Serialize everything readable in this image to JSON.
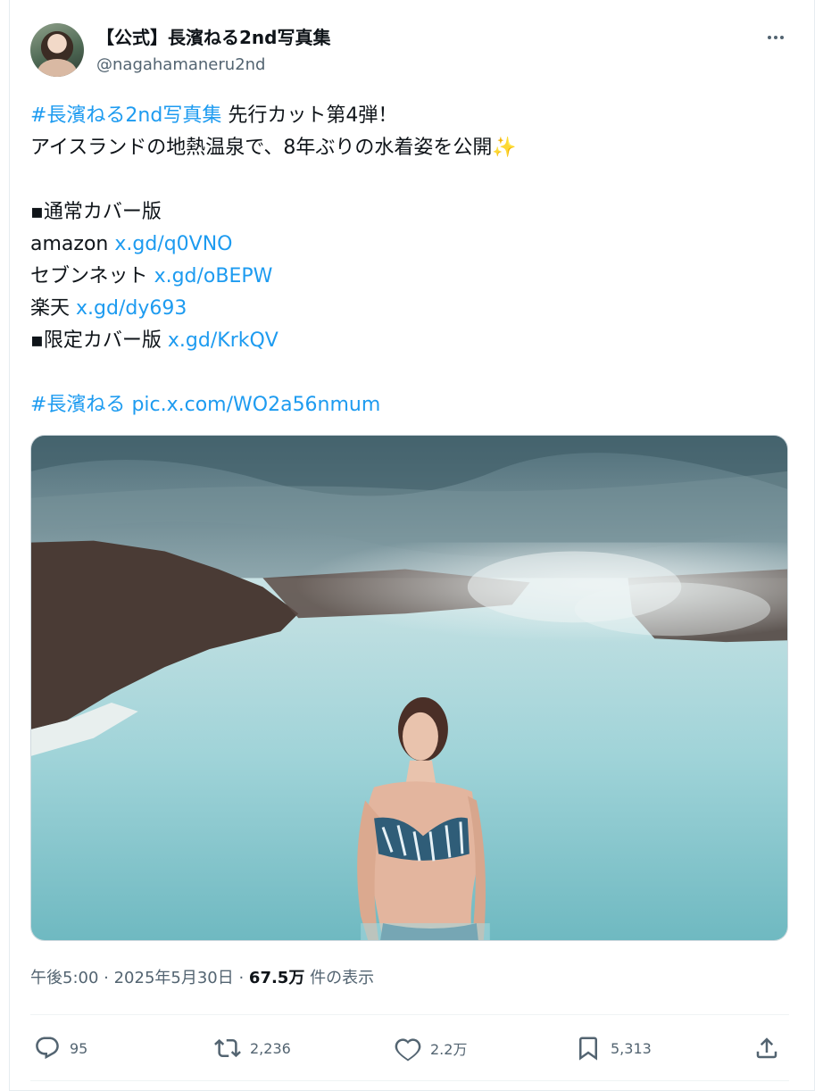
{
  "author": {
    "display_name": "【公式】長濱ねる2nd写真集",
    "handle": "@nagahamaneru2nd"
  },
  "tweet": {
    "line1_hashtag": "#長濱ねる2nd写真集",
    "line1_text": " 先行カット第4弾！",
    "line2_text": "アイスランドの地熱温泉で、8年ぶりの水着姿を公開",
    "line2_emoji": "✨",
    "section1": "▪通常カバー版",
    "amazon_label": "amazon ",
    "amazon_link": "x.gd/q0VNO",
    "seven_label": "セブンネット ",
    "seven_link": "x.gd/oBEPW",
    "rakuten_label": "楽天 ",
    "rakuten_link": "x.gd/dy693",
    "limited_label": "▪限定カバー版 ",
    "limited_link": "x.gd/KrkQV",
    "footer_hashtag": "#長濱ねる",
    "footer_pic_link": "pic.x.com/WO2a56nmum"
  },
  "meta": {
    "time": "午後5:00 · 2025年5月30日 · ",
    "views": "67.5万",
    "views_suffix": " 件の表示"
  },
  "actions": {
    "reply_count": "95",
    "repost_count": "2,236",
    "like_count": "2.2万",
    "bookmark_count": "5,313"
  },
  "colors": {
    "link": "#1d9bf0",
    "text": "#0f1419",
    "secondary": "#536471"
  }
}
